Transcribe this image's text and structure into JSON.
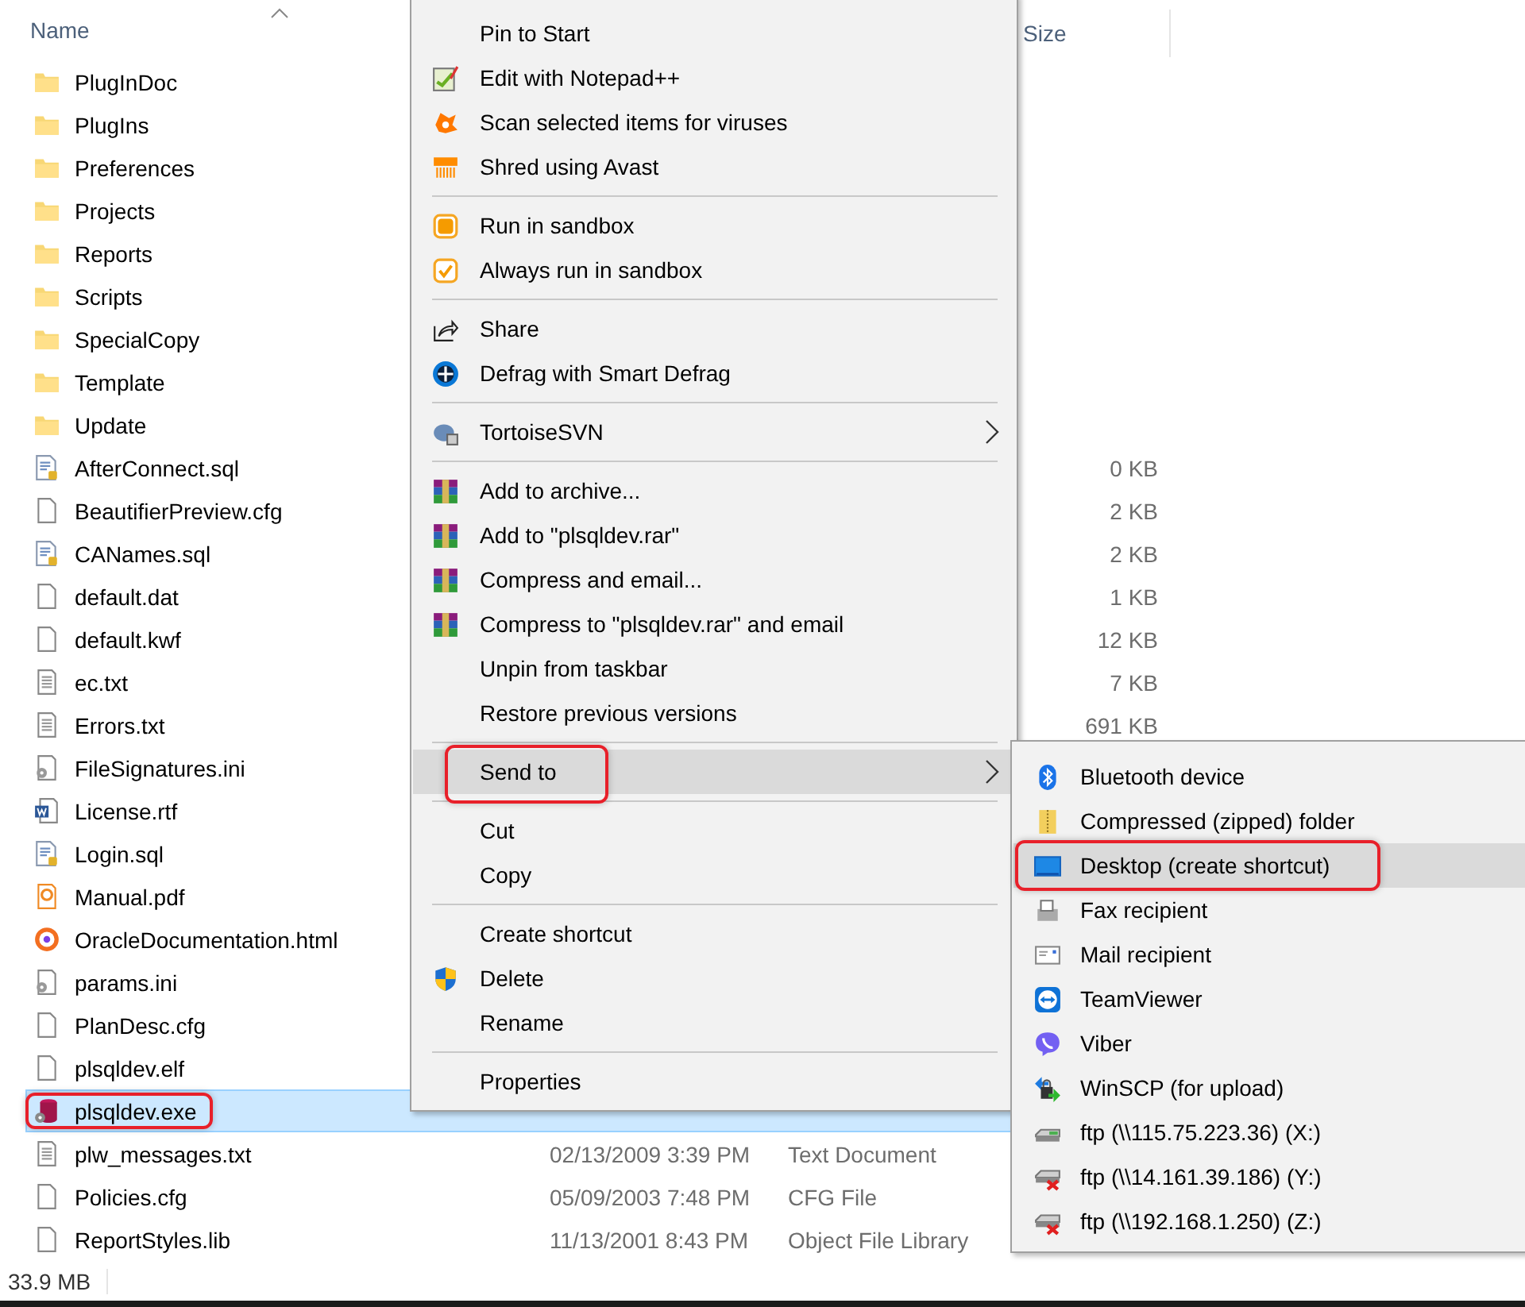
{
  "file_list": {
    "columns": [
      {
        "label": "Name",
        "sorted": true
      },
      {
        "label": "Size",
        "sorted": false
      }
    ],
    "rows": [
      {
        "name": "PlugInDoc",
        "kind": "folder",
        "selected": false,
        "annotated": false
      },
      {
        "name": "PlugIns",
        "kind": "folder",
        "selected": false,
        "annotated": false
      },
      {
        "name": "Preferences",
        "kind": "folder",
        "selected": false,
        "annotated": false
      },
      {
        "name": "Projects",
        "kind": "folder",
        "selected": false,
        "annotated": false
      },
      {
        "name": "Reports",
        "kind": "folder",
        "selected": false,
        "annotated": false
      },
      {
        "name": "Scripts",
        "kind": "folder",
        "selected": false,
        "annotated": false
      },
      {
        "name": "SpecialCopy",
        "kind": "folder",
        "selected": false,
        "annotated": false
      },
      {
        "name": "Template",
        "kind": "folder",
        "selected": false,
        "annotated": false
      },
      {
        "name": "Update",
        "kind": "folder",
        "selected": false,
        "annotated": false
      },
      {
        "name": "AfterConnect.sql",
        "kind": "sql",
        "size": "0 KB",
        "selected": false,
        "annotated": false
      },
      {
        "name": "BeautifierPreview.cfg",
        "kind": "file",
        "size": "2 KB",
        "selected": false,
        "annotated": false
      },
      {
        "name": "CANames.sql",
        "kind": "sql",
        "size": "2 KB",
        "selected": false,
        "annotated": false
      },
      {
        "name": "default.dat",
        "kind": "file",
        "size": "1 KB",
        "selected": false,
        "annotated": false
      },
      {
        "name": "default.kwf",
        "kind": "file",
        "size": "12 KB",
        "selected": false,
        "annotated": false
      },
      {
        "name": "ec.txt",
        "kind": "text",
        "size": "7 KB",
        "selected": false,
        "annotated": false
      },
      {
        "name": "Errors.txt",
        "kind": "text",
        "size": "691 KB",
        "selected": false,
        "annotated": false
      },
      {
        "name": "FileSignatures.ini",
        "kind": "ini",
        "selected": false,
        "annotated": false
      },
      {
        "name": "License.rtf",
        "kind": "word",
        "selected": false,
        "annotated": false
      },
      {
        "name": "Login.sql",
        "kind": "sql",
        "selected": false,
        "annotated": false
      },
      {
        "name": "Manual.pdf",
        "kind": "pdf",
        "selected": false,
        "annotated": false
      },
      {
        "name": "OracleDocumentation.html",
        "kind": "html",
        "selected": false,
        "annotated": false
      },
      {
        "name": "params.ini",
        "kind": "ini",
        "selected": false,
        "annotated": false
      },
      {
        "name": "PlanDesc.cfg",
        "kind": "file",
        "selected": false,
        "annotated": false
      },
      {
        "name": "plsqldev.elf",
        "kind": "file",
        "selected": false,
        "annotated": false
      },
      {
        "name": "plsqldev.exe",
        "kind": "exe",
        "selected": true,
        "annotated": true
      },
      {
        "name": "plw_messages.txt",
        "kind": "text",
        "date": "02/13/2009 3:39 PM",
        "type": "Text Document",
        "selected": false,
        "annotated": false
      },
      {
        "name": "Policies.cfg",
        "kind": "file",
        "date": "05/09/2003 7:48 PM",
        "type": "CFG File",
        "selected": false,
        "annotated": false
      },
      {
        "name": "ReportStyles.lib",
        "kind": "file",
        "date": "11/13/2001 8:43 PM",
        "type": "Object File Library",
        "selected": false,
        "annotated": false
      }
    ]
  },
  "context_menu": {
    "items": [
      {
        "kind": "item",
        "label": "Pin to Start"
      },
      {
        "kind": "item",
        "label": "Edit with Notepad++"
      },
      {
        "kind": "item",
        "label": "Scan selected items for viruses"
      },
      {
        "kind": "item",
        "label": "Shred using Avast"
      },
      {
        "kind": "separator"
      },
      {
        "kind": "item",
        "label": "Run in sandbox"
      },
      {
        "kind": "item",
        "label": "Always run in sandbox"
      },
      {
        "kind": "separator"
      },
      {
        "kind": "item",
        "label": "Share"
      },
      {
        "kind": "item",
        "label": "Defrag with Smart Defrag"
      },
      {
        "kind": "separator"
      },
      {
        "kind": "item",
        "label": "TortoiseSVN",
        "submenu": true
      },
      {
        "kind": "separator"
      },
      {
        "kind": "item",
        "label": "Add to archive..."
      },
      {
        "kind": "item",
        "label": "Add to \"plsqldev.rar\""
      },
      {
        "kind": "item",
        "label": "Compress and email..."
      },
      {
        "kind": "item",
        "label": "Compress to \"plsqldev.rar\" and email"
      },
      {
        "kind": "item",
        "label": "Unpin from taskbar"
      },
      {
        "kind": "item",
        "label": "Restore previous versions"
      },
      {
        "kind": "separator"
      },
      {
        "kind": "item",
        "label": "Send to",
        "submenu": true,
        "highlighted": true,
        "annotated": true
      },
      {
        "kind": "separator"
      },
      {
        "kind": "item",
        "label": "Cut"
      },
      {
        "kind": "item",
        "label": "Copy"
      },
      {
        "kind": "separator"
      },
      {
        "kind": "item",
        "label": "Create shortcut"
      },
      {
        "kind": "item",
        "label": "Delete"
      },
      {
        "kind": "item",
        "label": "Rename"
      },
      {
        "kind": "separator"
      },
      {
        "kind": "item",
        "label": "Properties"
      }
    ]
  },
  "send_to_menu": {
    "items": [
      {
        "label": "Bluetooth device",
        "highlighted": false,
        "annotated": false
      },
      {
        "label": "Compressed (zipped) folder",
        "highlighted": false,
        "annotated": false
      },
      {
        "label": "Desktop (create shortcut)",
        "highlighted": true,
        "annotated": true
      },
      {
        "label": "Fax recipient",
        "highlighted": false,
        "annotated": false
      },
      {
        "label": "Mail recipient",
        "highlighted": false,
        "annotated": false
      },
      {
        "label": "TeamViewer",
        "highlighted": false,
        "annotated": false
      },
      {
        "label": "Viber",
        "highlighted": false,
        "annotated": false
      },
      {
        "label": "WinSCP (for upload)",
        "highlighted": false,
        "annotated": false
      },
      {
        "label": "ftp (\\\\115.75.223.36) (X:)",
        "highlighted": false,
        "annotated": false
      },
      {
        "label": "ftp (\\\\14.161.39.186) (Y:)",
        "highlighted": false,
        "annotated": false
      },
      {
        "label": "ftp (\\\\192.168.1.250) (Z:)",
        "highlighted": false,
        "annotated": false
      }
    ]
  },
  "status_bar": {
    "text": "33.9 MB"
  }
}
